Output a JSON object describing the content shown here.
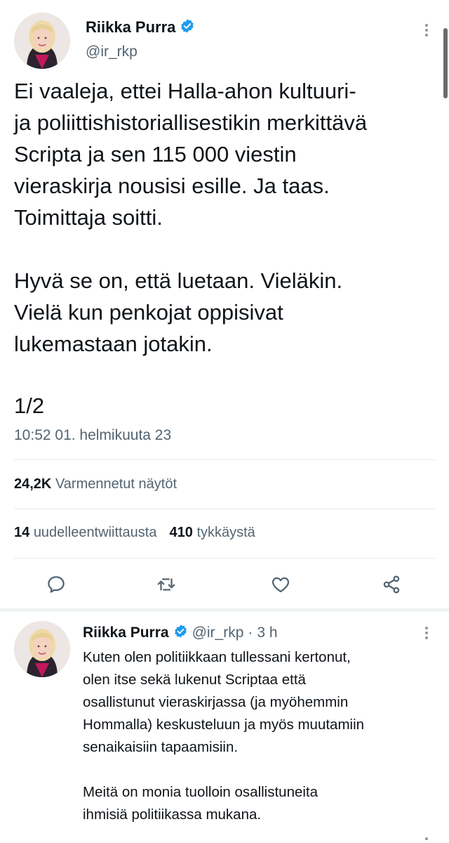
{
  "main_tweet": {
    "author_name": "Riikka Purra",
    "handle": "@ir_rkp",
    "text": "Ei vaaleja, ettei Halla-ahon kultuuri-\nja poliittishistoriallisestikin merkittävä\nScripta ja sen 115 000 viestin\nvieraskirja nousisi esille. Ja taas.\nToimittaja soitti.\n\nHyvä se on, että luetaan. Vieläkin.\nVielä kun penkojat oppisivat\nlukemastaan jotakin.",
    "thread_index": "1/2",
    "timestamp": "10:52 01. helmikuuta 23",
    "views_count": "24,2K",
    "views_label": "Varmennetut näytöt",
    "retweets_count": "14",
    "retweets_label": "uudelleentwiittausta",
    "likes_count": "410",
    "likes_label": "tykkäystä"
  },
  "reply_tweet": {
    "author_name": "Riikka Purra",
    "handle": "@ir_rkp",
    "separator": "·",
    "time_ago": "3 h",
    "text": "Kuten olen politiikkaan tullessani kertonut,\nolen itse sekä lukenut Scriptaa että\nosallistunut vieraskirjassa (ja myöhemmin\nHommalla) keskusteluun ja myös muutamiin\nsenaikaisiin tapaamisiin.\n\nMeitä on monia tuolloin osallistuneita\nihmisiä politiikassa mukana."
  },
  "icons": {
    "verified": "verified-badge-icon",
    "more": "more-vertical-icon",
    "reply": "reply-icon",
    "retweet": "retweet-icon",
    "like": "heart-icon",
    "share": "share-icon"
  },
  "colors": {
    "verified_blue": "#1d9bf0",
    "text_primary": "#0f1419",
    "text_secondary": "#536471",
    "divider": "#e6e9eb"
  }
}
